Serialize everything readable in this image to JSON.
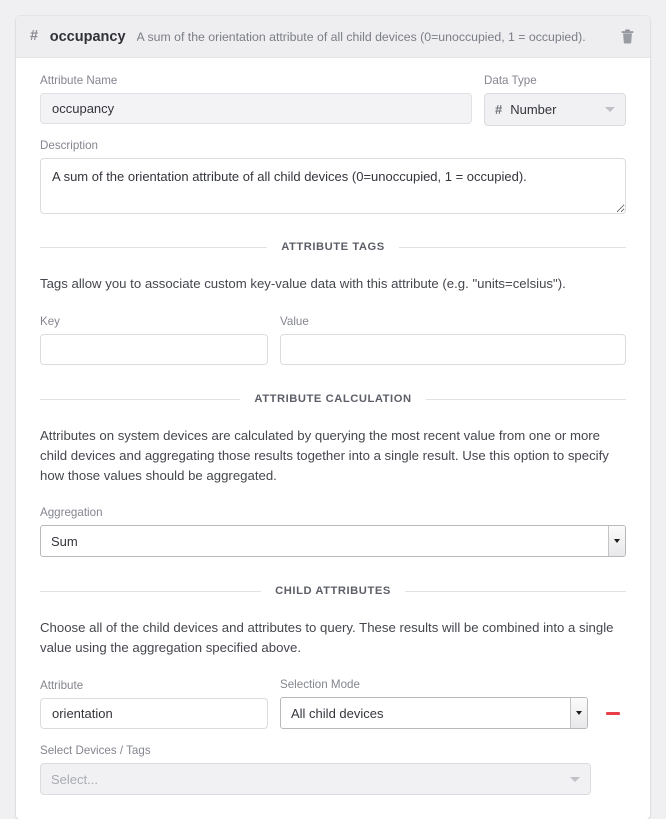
{
  "header": {
    "type_icon": "hash-icon",
    "title": "occupancy",
    "description": "A sum of the orientation attribute of all child devices (0=unoccupied, 1 = occupied).",
    "delete_icon": "trash-icon"
  },
  "attribute": {
    "name_label": "Attribute Name",
    "name_value": "occupancy",
    "data_type_label": "Data Type",
    "data_type_value": "Number",
    "data_type_icon": "hash-icon",
    "description_label": "Description",
    "description_value": "A sum of the orientation attribute of all child devices (0=unoccupied, 1 = occupied)."
  },
  "tags_section": {
    "divider_label": "ATTRIBUTE TAGS",
    "help": "Tags allow you to associate custom key-value data with this attribute (e.g. \"units=celsius\").",
    "key_label": "Key",
    "key_value": "",
    "value_label": "Value",
    "value_value": ""
  },
  "calculation_section": {
    "divider_label": "ATTRIBUTE CALCULATION",
    "help": "Attributes on system devices are calculated by querying the most recent value from one or more child devices and aggregating those results together into a single result. Use this option to specify how those values should be aggregated.",
    "aggregation_label": "Aggregation",
    "aggregation_value": "Sum"
  },
  "child_attributes_section": {
    "divider_label": "CHILD ATTRIBUTES",
    "help": "Choose all of the child devices and attributes to query. These results will be combined into a single value using the aggregation specified above.",
    "attribute_label": "Attribute",
    "attribute_value": "orientation",
    "selection_mode_label": "Selection Mode",
    "selection_mode_value": "All child devices",
    "remove_icon": "minus-icon",
    "devices_label": "Select Devices / Tags",
    "devices_placeholder": "Select..."
  },
  "colors": {
    "page_background": "#f0f0f2",
    "card_background": "#ffffff",
    "header_background": "#eeeef0",
    "accent_danger": "#e8404a",
    "label_text": "#84868f",
    "body_text": "#45474e"
  }
}
